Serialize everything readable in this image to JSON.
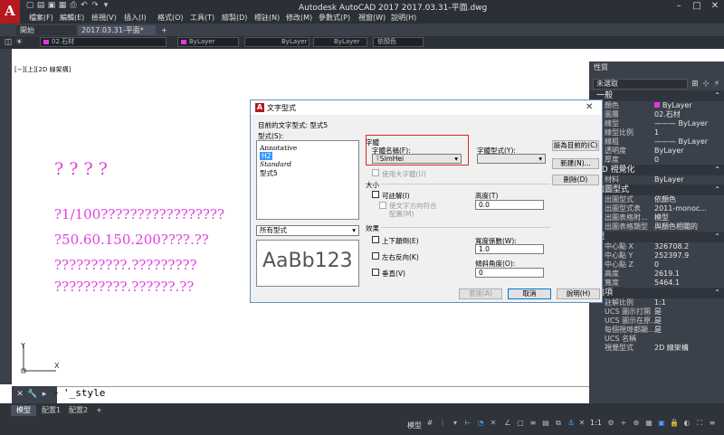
{
  "app": {
    "window_title": "Autodesk AutoCAD 2017    2017.03.31-平面.dwg",
    "logo_letter": "A"
  },
  "menu": [
    "檔案(F)",
    "編輯(E)",
    "檢視(V)",
    "插入(I)",
    "格式(O)",
    "工具(T)",
    "繪製(D)",
    "標註(N)",
    "修改(M)",
    "參數式(P)",
    "視窗(W)",
    "說明(H)"
  ],
  "doc_tabs": {
    "start": "開始",
    "file": "2017.03.31-平面*",
    "add": "+"
  },
  "prop_bar": {
    "layer": "02.石材",
    "color": "ByLayer",
    "linetype": "ByLayer",
    "lineweight": "ByLayer",
    "plotstyle": "依顏色"
  },
  "viewport_label": "[−][上][2D 線架構]",
  "drawing_text": [
    "? ? ? ?",
    "?1/100?????????????????",
    "?50.60.150.200????.??",
    "??????????.?????????",
    "??????????.??????.??"
  ],
  "command": {
    "prompt": "'_style",
    "symbol": "▸"
  },
  "layout_tabs": [
    "模型",
    "配置1",
    "配置2"
  ],
  "status": {
    "model_label": "模型",
    "scale": "1:1"
  },
  "palette": {
    "title": "性質",
    "selection": "未選取",
    "sections": [
      {
        "title": "一般",
        "rows": [
          {
            "k": "顏色",
            "v": "ByLayer",
            "swatch": true
          },
          {
            "k": "圖層",
            "v": "02.石材"
          },
          {
            "k": "線型",
            "v": "——— ByLayer"
          },
          {
            "k": "線型比例",
            "v": "1"
          },
          {
            "k": "線粗",
            "v": "——— ByLayer"
          },
          {
            "k": "透明度",
            "v": "ByLayer"
          },
          {
            "k": "厚度",
            "v": "0"
          }
        ]
      },
      {
        "title": "3D 視覺化",
        "rows": [
          {
            "k": "材料",
            "v": "ByLayer"
          }
        ]
      },
      {
        "title": "出圖型式",
        "rows": [
          {
            "k": "出圖型式",
            "v": "依顏色"
          },
          {
            "k": "出圖型式表",
            "v": "2011-monoc..."
          },
          {
            "k": "出圖表格附...",
            "v": "模型"
          },
          {
            "k": "出圖表格類型",
            "v": "與顏色相關的"
          }
        ]
      },
      {
        "title": "視",
        "rows": [
          {
            "k": "中心點 X",
            "v": "326708.2"
          },
          {
            "k": "中心點 Y",
            "v": "252397.9"
          },
          {
            "k": "中心點 Z",
            "v": "0"
          },
          {
            "k": "高度",
            "v": "2619.1"
          },
          {
            "k": "寬度",
            "v": "5464.1"
          }
        ]
      },
      {
        "title": "雜項",
        "rows": [
          {
            "k": "註解比例",
            "v": "1:1"
          },
          {
            "k": "UCS 圖示打開",
            "v": "是"
          },
          {
            "k": "UCS 圖示在原...",
            "v": "是"
          },
          {
            "k": "每個視埠都顯...",
            "v": "是"
          },
          {
            "k": "UCS 名稱",
            "v": ""
          },
          {
            "k": "視覺型式",
            "v": "2D 線架構"
          }
        ]
      }
    ]
  },
  "dialog": {
    "title": "文字型式",
    "current_style_label": "目前的文字型式: 型式5",
    "styles_label": "型式(S):",
    "styles": [
      "Annotative",
      "H2",
      "Standard",
      "型式5"
    ],
    "filter_value": "所有型式",
    "preview_text": "AaBb123",
    "font_group": "字體",
    "font_name_label": "字體名稱(F):",
    "font_name_value": "SimHei",
    "font_style_label": "字體型式(Y):",
    "font_style_value": "",
    "bigfont_label": "使用大字體(U)",
    "size_group": "大小",
    "annotative_label": "可註解(I)",
    "match_label_1": "使文字方向符合",
    "match_label_2": "配置(M)",
    "height_label": "高度(T)",
    "height_value": "0.0",
    "effects_group": "效果",
    "upside_down_label": "上下顛倒(E)",
    "backwards_label": "左右反向(K)",
    "vertical_label": "垂直(V)",
    "width_label": "寬度係數(W):",
    "width_value": "1.0",
    "oblique_label": "傾斜角度(O):",
    "oblique_value": "0",
    "btn_set_current": "設為目前的(C)",
    "btn_new": "新建(N)...",
    "btn_delete": "刪除(D)",
    "btn_apply": "套用(A)",
    "btn_cancel": "取消",
    "btn_help": "說明(H)",
    "highlight_color": "#e02424"
  },
  "colors": {
    "accent": "#b3191e",
    "drawing_text": "#e040e0",
    "dark_ui": "#3b414b"
  }
}
